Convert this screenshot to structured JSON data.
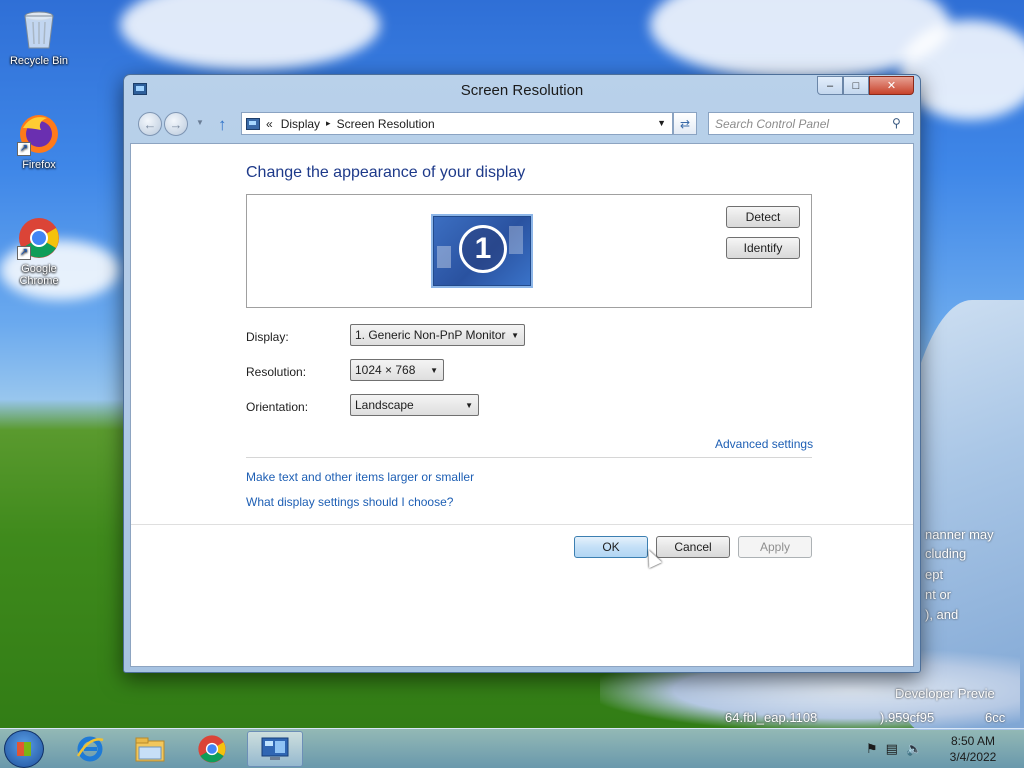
{
  "desktop": {
    "icons": [
      {
        "label": "Recycle Bin"
      },
      {
        "label": "Firefox"
      },
      {
        "label": "Google Chrome"
      }
    ],
    "watermark_lines": [
      "nanner may",
      "cluding",
      "ept",
      "nt or",
      "), and",
      "Developer Previe",
      "64.fbl_eap.1108",
      ").959cf95",
      "6cc"
    ]
  },
  "window": {
    "title": "Screen Resolution",
    "controls": {
      "minimize": "–",
      "maximize": "□",
      "close": "✕"
    },
    "address": {
      "prefix": "«",
      "crumbs": [
        "Display",
        "Screen Resolution"
      ],
      "separator": "▸"
    },
    "search": {
      "placeholder": "Search Control Panel"
    },
    "content": {
      "heading": "Change the appearance of your display",
      "monitor_number": "1",
      "detect_label": "Detect",
      "identify_label": "Identify",
      "display": {
        "label": "Display:",
        "value": "1. Generic Non-PnP Monitor"
      },
      "resolution": {
        "label": "Resolution:",
        "value": "1024 × 768"
      },
      "orientation": {
        "label": "Orientation:",
        "value": "Landscape"
      },
      "advanced_link": "Advanced settings",
      "links": [
        "Make text and other items larger or smaller",
        "What display settings should I choose?"
      ],
      "ok_label": "OK",
      "cancel_label": "Cancel",
      "apply_label": "Apply"
    }
  },
  "taskbar": {
    "items": [
      {
        "icon": "internet-explorer-icon"
      },
      {
        "icon": "file-explorer-icon"
      },
      {
        "icon": "chrome-icon"
      },
      {
        "icon": "control-panel-icon",
        "active": true
      }
    ],
    "clock": {
      "time": "8:50 AM",
      "date": "3/4/2022"
    }
  },
  "colors": {
    "link": "#1e5fb4",
    "heading": "#1e3a8a",
    "close": "#c7432c"
  }
}
